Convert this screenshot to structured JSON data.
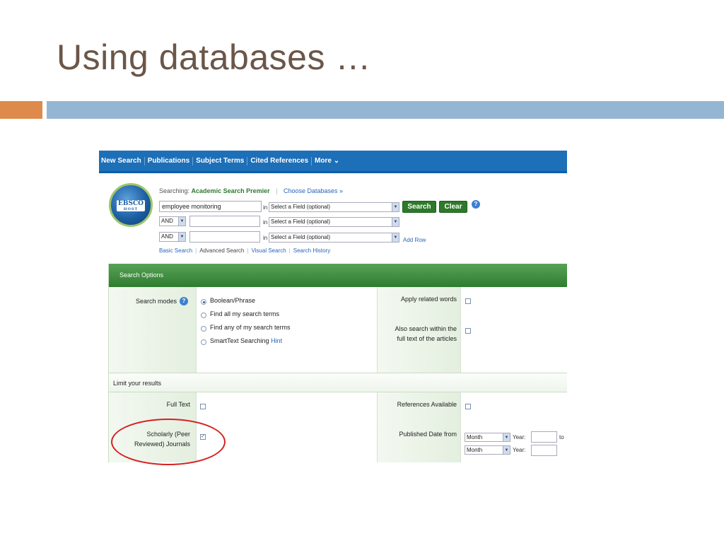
{
  "slide": {
    "title": "Using databases …"
  },
  "nav": {
    "items": [
      "New Search",
      "Publications",
      "Subject Terms",
      "Cited References",
      "More ⌄"
    ]
  },
  "logo": {
    "text": "EBSCO",
    "subtext": "HOST"
  },
  "searching": {
    "label": "Searching:",
    "database": "Academic Search Premier",
    "choose": "Choose Databases »"
  },
  "search": {
    "row1_value": "employee monitoring",
    "row2_op": "AND",
    "row3_op": "AND",
    "in_label": "in",
    "field_placeholder": "Select a Field (optional)",
    "search_btn": "Search",
    "clear_btn": "Clear",
    "help": "?",
    "add_row": "Add Row"
  },
  "links": {
    "basic": "Basic Search",
    "advanced": "Advanced Search",
    "visual": "Visual Search",
    "history": "Search History"
  },
  "options": {
    "header": "Search Options",
    "modes_label": "Search modes",
    "modes": [
      "Boolean/Phrase",
      "Find all my search terms",
      "Find any of my search terms",
      "SmartText Searching"
    ],
    "hint": "Hint",
    "apply_related": "Apply related words",
    "also_search_1": "Also search within the",
    "also_search_2": "full text of the articles"
  },
  "limits": {
    "header": "Limit your results",
    "full_text": "Full Text",
    "scholarly_1": "Scholarly (Peer",
    "scholarly_2": "Reviewed) Journals",
    "references": "References Available",
    "published": "Published Date from",
    "month": "Month",
    "year_label": "Year:",
    "to": "to"
  },
  "colors": {
    "nav": "#1d6fb8",
    "green": "#2d7a2a",
    "title": "#6b5648",
    "orange": "#de8a4c",
    "blue_band": "#94b6d3",
    "circle": "#d62020"
  }
}
